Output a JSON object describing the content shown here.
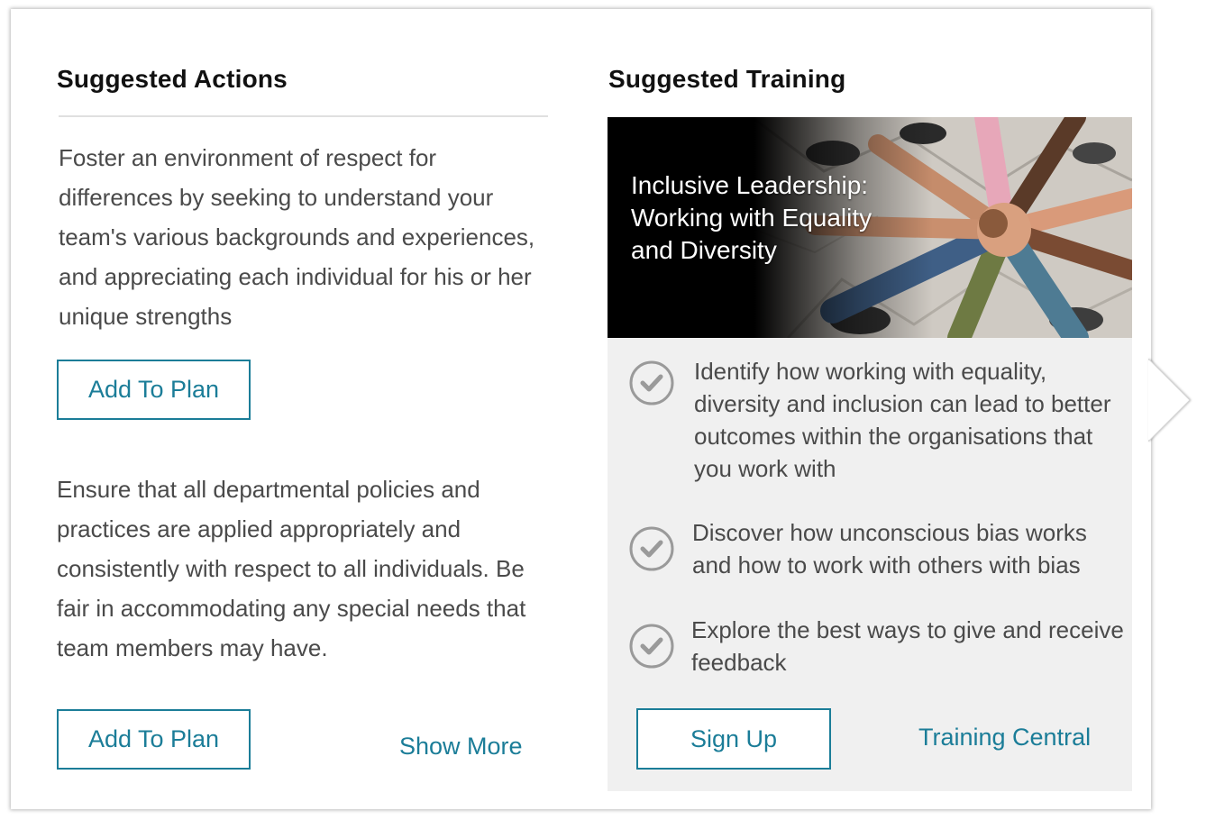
{
  "actions": {
    "title": "Suggested Actions",
    "items": [
      {
        "text": "Foster an environment of respect for differences by seeking to understand your team's various backgrounds and experiences, and appreciating each individual for his or her unique strengths",
        "button_label": "Add To Plan"
      },
      {
        "text": "Ensure that all departmental policies and practices are applied appropriately and consistently with respect to all individuals. Be fair in accommodating any special needs that team members may have.",
        "button_label": "Add To Plan"
      }
    ],
    "show_more_label": "Show More"
  },
  "training": {
    "title": "Suggested Training",
    "course_title": "Inclusive Leadership: Working with Equality and Diversity",
    "outcomes": [
      "Identify how working with equality, diversity and inclusion can lead to better outcomes within the organisations that you work with",
      "Discover how unconscious bias works and how to work with others with bias",
      "Explore the best ways to give and receive feedback"
    ],
    "signup_label": "Sign Up",
    "central_link_label": "Training Central"
  },
  "icons": {
    "check": "check-circle-icon",
    "banner_image": "team-hands-photo"
  },
  "colors": {
    "accent": "#1b7d98",
    "panel_bg": "#f0f0f0",
    "text": "#4a4a4a"
  }
}
